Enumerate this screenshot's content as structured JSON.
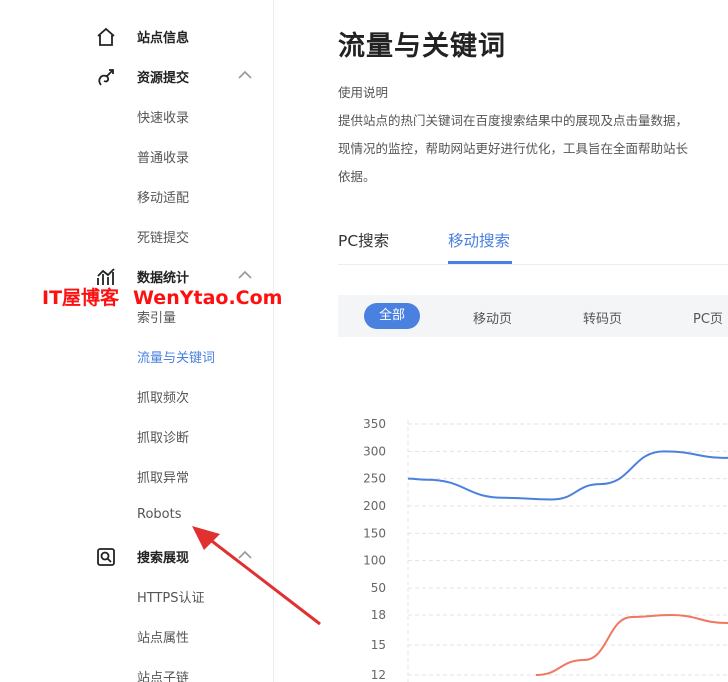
{
  "sidebar": {
    "sections": [
      {
        "title": "站点信息",
        "icon": "home-icon",
        "items": []
      },
      {
        "title": "资源提交",
        "icon": "submit-icon",
        "items": [
          "快速收录",
          "普通收录",
          "移动适配",
          "死链提交"
        ]
      },
      {
        "title": "数据统计",
        "icon": "stats-icon",
        "items": [
          "索引量",
          "流量与关键词",
          "抓取频次",
          "抓取诊断",
          "抓取异常",
          "Robots"
        ]
      },
      {
        "title": "搜索展现",
        "icon": "search-display-icon",
        "items": [
          "HTTPS认证",
          "站点属性",
          "站点子链"
        ]
      }
    ],
    "active_item": "流量与关键词"
  },
  "main": {
    "title": "流量与关键词",
    "usage_label": "使用说明",
    "description_lines": [
      "提供站点的热门关键词在百度搜索结果中的展现及点击量数据，",
      "现情况的监控，帮助网站更好进行优化，工具旨在全面帮助站长",
      "依据。"
    ],
    "tabs": [
      "PC搜索",
      "移动搜索"
    ],
    "active_tab": "移动搜索",
    "filters": [
      "全部",
      "移动页",
      "转码页",
      "PC页"
    ],
    "active_filter": "全部"
  },
  "watermark": {
    "text_a": "IT屋博客",
    "text_b": "WenYtao.Com",
    "color": "#ff1010"
  },
  "colors": {
    "accent": "#4a80e0",
    "series_top": "#4a80e0",
    "series_bottom": "#f07860"
  },
  "chart_data": [
    {
      "type": "line",
      "y_ticks": [
        350,
        300,
        250,
        200,
        150,
        100,
        50
      ],
      "ylim": [
        50,
        350
      ],
      "series": [
        {
          "points": [
            [
              0,
              250
            ],
            [
              0.06,
              248
            ],
            [
              0.3,
              215
            ],
            [
              0.45,
              212
            ],
            [
              0.6,
              240
            ],
            [
              0.8,
              300
            ],
            [
              1,
              288
            ]
          ]
        }
      ],
      "grid": true
    },
    {
      "type": "line",
      "y_ticks": [
        18,
        15,
        12
      ],
      "ylim": [
        12,
        18
      ],
      "series": [
        {
          "points": [
            [
              0.4,
              12
            ],
            [
              0.55,
              13.5
            ],
            [
              0.7,
              17.8
            ],
            [
              0.82,
              18
            ],
            [
              1,
              17.2
            ]
          ]
        }
      ],
      "grid": true
    }
  ]
}
